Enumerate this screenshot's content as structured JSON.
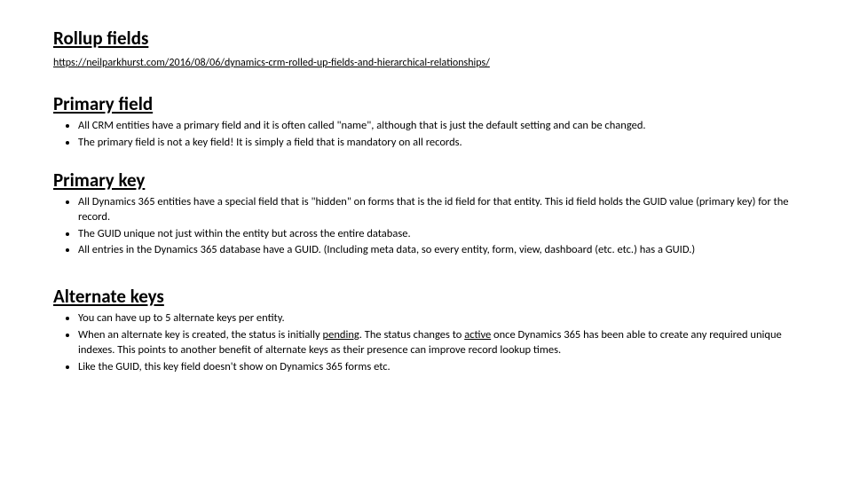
{
  "sections": {
    "rollup": {
      "title": "Rollup fields",
      "link": "https://neilparkhurst.com/2016/08/06/dynamics-crm-rolled-up-fields-and-hierarchical-relationships/"
    },
    "primary_field": {
      "title": "Primary field",
      "bullets": [
        "All CRM entities have a primary field and it is often called \"name\", although that is just the default setting and can be changed.",
        "The primary field is not a key field! It is simply a field that is mandatory on all records."
      ]
    },
    "primary_key": {
      "title": "Primary key",
      "bullets": [
        "All Dynamics 365 entities have a special field that is \"hidden\" on forms that is the id field for that entity. This id field holds the GUID value (primary key) for the record.",
        " The GUID unique not just within the entity but across the entire database.",
        "All entries in the Dynamics 365 database have a GUID. (Including meta data, so every entity, form, view, dashboard (etc. etc.) has a GUID.)"
      ]
    },
    "alternate_keys": {
      "title": "Alternate keys",
      "bullets": [
        "You can have up to 5 alternate keys per entity.",
        {
          "pre": "When an alternate key is created, the status is initially ",
          "u1": "pending",
          "mid": ". The status changes to ",
          "u2": "active",
          "post": " once Dynamics 365 has been able to create any required unique indexes. This points to another benefit of alternate keys as their presence can improve record lookup times."
        },
        "Like the GUID, this key field doesn't show on Dynamics 365 forms etc."
      ]
    }
  }
}
